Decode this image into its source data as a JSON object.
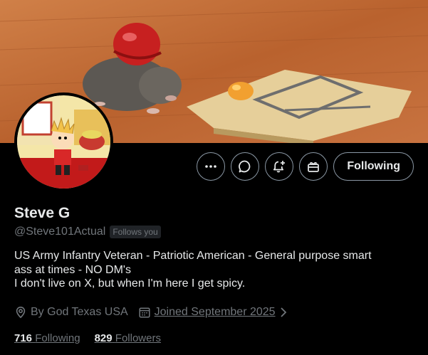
{
  "profile": {
    "name": "Steve G",
    "handle": "@Steve101Actual",
    "follows_you": "Follows you",
    "bio_lines": [
      "US Army Infantry Veteran  - Patriotic American -  General purpose smart",
      "ass at times  - NO DM's",
      "I don't live on X, but when I'm here I get spicy."
    ],
    "location": "By God Texas USA",
    "joined": "Joined September 2025",
    "following_count": "716",
    "following_label": "Following",
    "followers_count": "829",
    "followers_label": "Followers"
  },
  "actions": {
    "more_icon": "more-icon",
    "message_icon": "message-icon",
    "notify_icon": "bell-plus-icon",
    "gift_icon": "gift-icon",
    "following_label": "Following"
  },
  "colors": {
    "background": "#000000",
    "text_primary": "#e7e9ea",
    "text_secondary": "#71767b",
    "border": "#8b98a5"
  }
}
